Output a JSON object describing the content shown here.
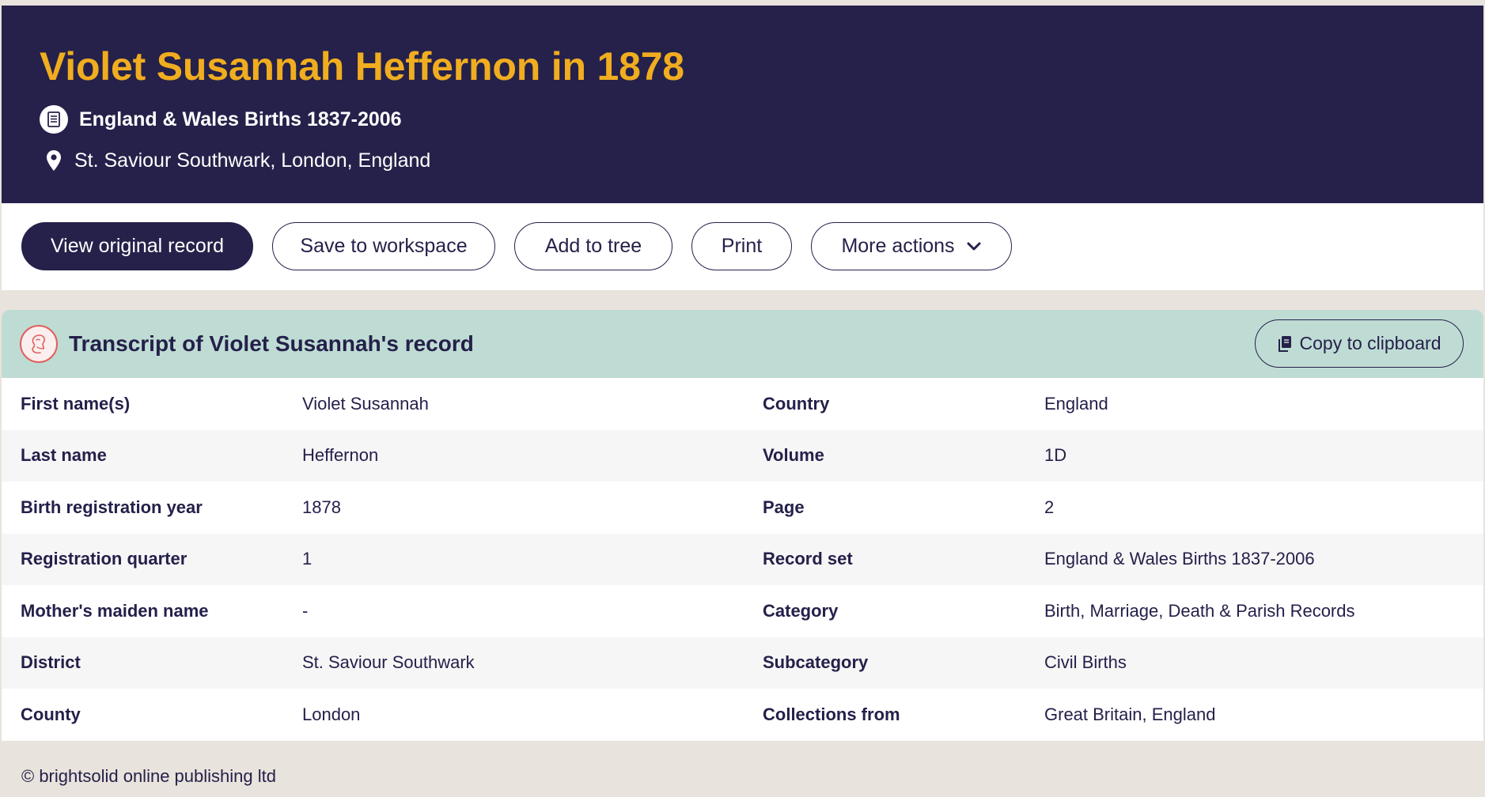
{
  "header": {
    "title": "Violet Susannah Heffernon in 1878",
    "record_set": "England & Wales Births 1837-2006",
    "location": "St. Saviour Southwark, London, England"
  },
  "actions": {
    "view_original": "View original record",
    "save_workspace": "Save to workspace",
    "add_tree": "Add to tree",
    "print": "Print",
    "more_actions": "More actions"
  },
  "transcript": {
    "title": "Transcript of Violet Susannah's record",
    "copy_label": "Copy to clipboard",
    "rows": [
      {
        "label_left": "First name(s)",
        "value_left": "Violet Susannah",
        "label_right": "Country",
        "value_right": "England"
      },
      {
        "label_left": "Last name",
        "value_left": "Heffernon",
        "label_right": "Volume",
        "value_right": "1D"
      },
      {
        "label_left": "Birth registration year",
        "value_left": "1878",
        "label_right": "Page",
        "value_right": "2"
      },
      {
        "label_left": "Registration quarter",
        "value_left": "1",
        "label_right": "Record set",
        "value_right": "England & Wales Births 1837-2006"
      },
      {
        "label_left": "Mother's maiden name",
        "value_left": "-",
        "label_right": "Category",
        "value_right": "Birth, Marriage, Death & Parish Records"
      },
      {
        "label_left": "District",
        "value_left": "St. Saviour Southwark",
        "label_right": "Subcategory",
        "value_right": "Civil Births"
      },
      {
        "label_left": "County",
        "value_left": "London",
        "label_right": "Collections from",
        "value_right": "Great Britain, England"
      }
    ]
  },
  "footer": {
    "copyright": "© brightsolid online publishing ltd"
  },
  "colors": {
    "navy": "#25214a",
    "gold": "#f0ad1f",
    "mint": "#bfdcd4",
    "background": "#e8e3dc",
    "accent_red": "#e0605b"
  },
  "icons": {
    "record_set": "document-icon",
    "location": "map-pin-icon",
    "more_actions": "chevron-down-icon",
    "transcript": "portrait-icon",
    "copy": "clipboard-icon"
  }
}
